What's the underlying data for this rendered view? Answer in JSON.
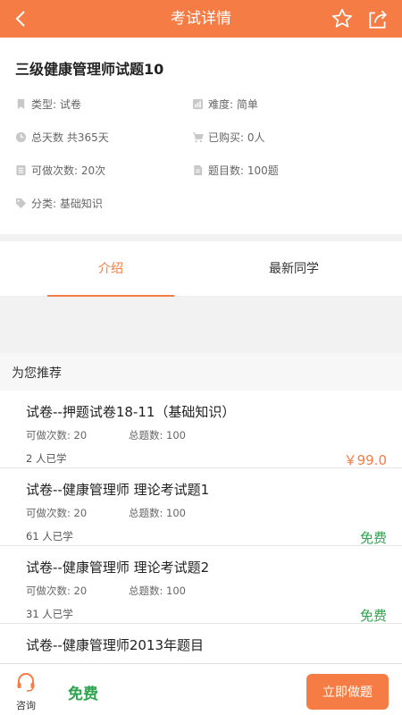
{
  "header": {
    "title": "考试详情",
    "back_icon": "back-arrow-icon",
    "favorite_icon": "star-icon",
    "share_icon": "share-icon"
  },
  "exam": {
    "title": "三级健康管理师试题10",
    "type_label": "类型: 试卷",
    "difficulty_label": "难度: 简单",
    "duration_label": "总天数 共365天",
    "purchased_label": "已购买: 0人",
    "attempts_label": "可做次数: 20次",
    "questions_label": "题目数: 100题",
    "category_label": "分类: 基础知识"
  },
  "tabs": [
    {
      "label": "介绍",
      "active": true
    },
    {
      "label": "最新同学",
      "active": false
    }
  ],
  "recommend": {
    "header": "为您推荐",
    "items": [
      {
        "name": "试卷--押题试卷18-11（基础知识）",
        "attempts": "可做次数: 20",
        "questions": "总题数: 100",
        "learners": "2 人已学",
        "price": "￥99.0",
        "price_type": "paid"
      },
      {
        "name": "试卷--健康管理师 理论考试题1",
        "attempts": "可做次数: 20",
        "questions": "总题数: 100",
        "learners": "61 人已学",
        "price": "免费",
        "price_type": "free"
      },
      {
        "name": "试卷--健康管理师 理论考试题2",
        "attempts": "可做次数: 20",
        "questions": "总题数: 100",
        "learners": "31 人已学",
        "price": "免费",
        "price_type": "free"
      },
      {
        "name": "试卷--健康管理师2013年题目",
        "attempts": "",
        "questions": "",
        "learners": "",
        "price": "",
        "price_type": "free"
      }
    ]
  },
  "bottom": {
    "consult_label": "咨询",
    "price_label": "免费",
    "start_button": "立即做题"
  },
  "colors": {
    "accent": "#f57c45",
    "free": "#2ea44f"
  }
}
